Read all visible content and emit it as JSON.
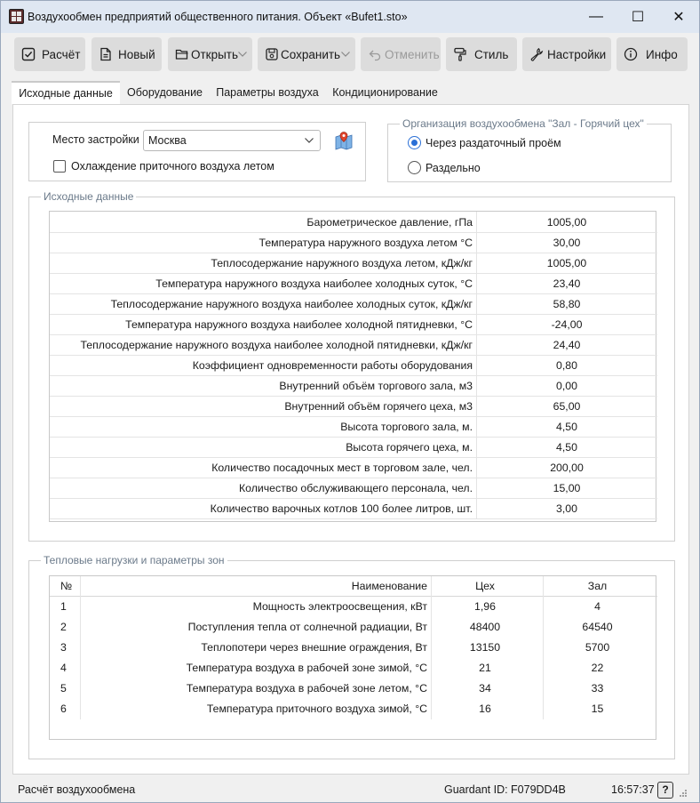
{
  "window": {
    "title": "Воздухообмен предприятий общественного питания. Объект «Bufet1.sto»",
    "minimize_glyph": "—",
    "maximize_glyph": "☐",
    "close_glyph": "✕"
  },
  "toolbar": {
    "calc_label": "Расчёт",
    "new_label": "Новый",
    "open_label": "Открыть",
    "save_label": "Сохранить",
    "undo_label": "Отменить",
    "style_label": "Стиль",
    "settings_label": "Настройки",
    "info_label": "Инфо"
  },
  "tabs": [
    "Исходные данные",
    "Оборудование",
    "Параметры воздуха",
    "Кондиционирование"
  ],
  "location": {
    "label": "Место застройки",
    "value": "Москва",
    "cooling_label": "Охлаждение приточного воздуха летом"
  },
  "org": {
    "title": "Организация воздухообмена \"Зал - Горячий цех\"",
    "option1": "Через раздаточный проём",
    "option2": "Раздельно"
  },
  "source": {
    "title": "Исходные данные",
    "rows": [
      {
        "name": "Барометрическое давление, гПа",
        "value": "1005,00"
      },
      {
        "name": "Температура наружного воздуха летом °С",
        "value": "30,00"
      },
      {
        "name": "Теплосодержание наружного воздуха летом, кДж/кг",
        "value": "1005,00"
      },
      {
        "name": "Температура наружного воздуха наиболее холодных суток, °С",
        "value": "23,40"
      },
      {
        "name": "Теплосодержание наружного воздуха наиболее холодных суток, кДж/кг",
        "value": "58,80"
      },
      {
        "name": "Температура наружного воздуха наиболее холодной пятидневки, °С",
        "value": "-24,00"
      },
      {
        "name": "Теплосодержание наружного воздуха наиболее холодной пятидневки, кДж/кг",
        "value": "24,40"
      },
      {
        "name": "Коэффициент одновременности работы оборудования",
        "value": "0,80"
      },
      {
        "name": "Внутренний объём торгового зала, м3",
        "value": "0,00"
      },
      {
        "name": "Внутренний объём горячего цеха, м3",
        "value": "65,00"
      },
      {
        "name": "Высота торгового зала, м.",
        "value": "4,50"
      },
      {
        "name": "Высота горячего цеха, м.",
        "value": "4,50"
      },
      {
        "name": "Количество посадочных мест в торговом зале, чел.",
        "value": "200,00"
      },
      {
        "name": "Количество обслуживающего персонала, чел.",
        "value": "15,00"
      },
      {
        "name": "Количество варочных котлов 100 более литров, шт.",
        "value": "3,00"
      }
    ]
  },
  "loads": {
    "title": "Тепловые нагрузки и параметры зон",
    "headers": {
      "num": "№",
      "name": "Наименование",
      "shop": "Цех",
      "hall": "Зал"
    },
    "rows": [
      {
        "num": "1",
        "name": "Мощность электроосвещения, кВт",
        "shop": "1,96",
        "hall": "4"
      },
      {
        "num": "2",
        "name": "Поступления тепла от солнечной радиации, Вт",
        "shop": "48400",
        "hall": "64540"
      },
      {
        "num": "3",
        "name": "Теплопотери через внешние ограждения, Вт",
        "shop": "13150",
        "hall": "5700"
      },
      {
        "num": "4",
        "name": "Температура воздуха в рабочей зоне зимой, °С",
        "shop": "21",
        "hall": "22"
      },
      {
        "num": "5",
        "name": "Температура воздуха в рабочей зоне летом, °С",
        "shop": "34",
        "hall": "33"
      },
      {
        "num": "6",
        "name": "Температура приточного воздуха зимой, °С",
        "shop": "16",
        "hall": "15"
      }
    ]
  },
  "status": {
    "left": "Расчёт воздухообмена",
    "guardian": "Guardant ID: F079DD4B",
    "time": "16:57:37",
    "help": "?"
  },
  "colors": {
    "accent": "#2a6fd6",
    "button_bg": "#dcdcdc",
    "titlebar_bg": "#dfe7f2"
  }
}
